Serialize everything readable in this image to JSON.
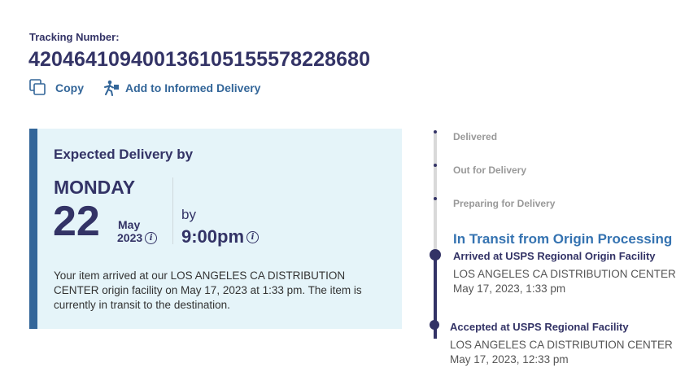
{
  "tracking": {
    "label": "Tracking Number:",
    "number": "420464109400136105155578228680"
  },
  "actions": {
    "copy_label": "Copy",
    "informed_label": "Add to Informed Delivery"
  },
  "delivery": {
    "title": "Expected Delivery by",
    "day_name": "MONDAY",
    "day_number": "22",
    "month": "May",
    "year": "2023",
    "by_label": "by",
    "time": "9:00pm",
    "info_glyph": "i",
    "message": "Your item arrived at our LOS ANGELES CA DISTRIBUTION CENTER origin facility on May 17, 2023 at 1:33 pm. The item is currently in transit to the destination."
  },
  "progress": {
    "upcoming_steps": [
      "Delivered",
      "Out for Delivery",
      "Preparing for Delivery"
    ],
    "current_status": "In Transit from Origin Processing",
    "events": [
      {
        "title": "Arrived at USPS Regional Origin Facility",
        "location": "LOS ANGELES CA DISTRIBUTION CENTER",
        "datetime": "May 17, 2023, 1:33 pm"
      },
      {
        "title": "Accepted at USPS Regional Facility",
        "location": "LOS ANGELES CA DISTRIBUTION CENTER",
        "datetime": "May 17, 2023, 12:33 pm"
      }
    ]
  },
  "icons": {
    "copy": "copy-icon",
    "informed": "informed-delivery-icon",
    "info": "info-icon"
  },
  "colors": {
    "navy": "#333366",
    "link_blue": "#336699",
    "status_blue": "#3573b1",
    "card_bg": "#e5f4f9",
    "track_gray": "#d9d9d9"
  }
}
